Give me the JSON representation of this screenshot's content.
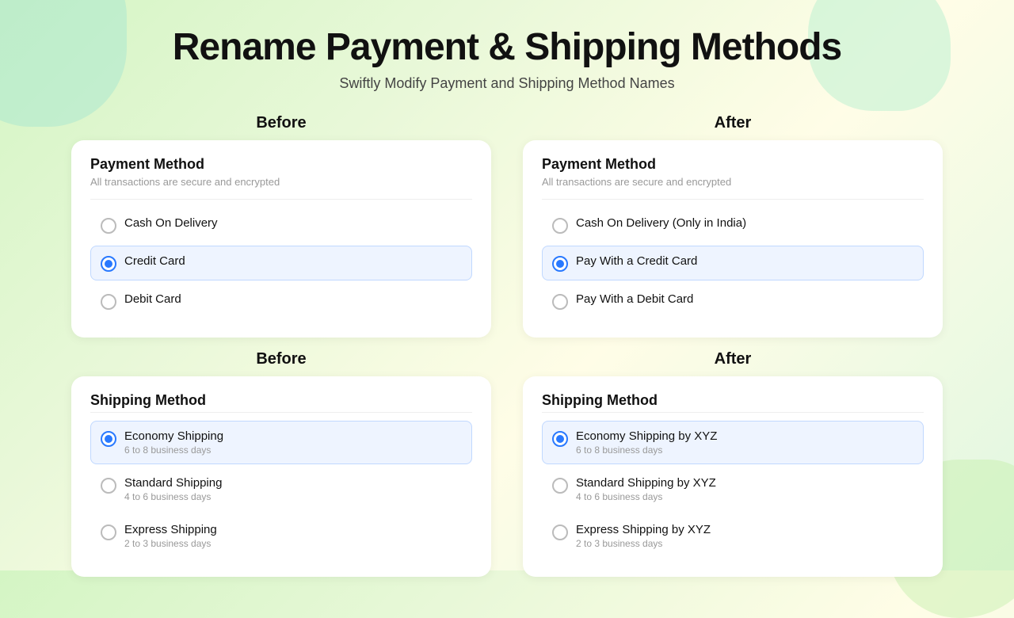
{
  "page": {
    "title": "Rename Payment & Shipping Methods",
    "subtitle": "Swiftly Modify Payment and Shipping Method Names"
  },
  "paymentBefore": {
    "section_label": "Before",
    "card_title": "Payment Method",
    "card_subtitle": "All transactions are secure and encrypted",
    "options": [
      {
        "label": "Cash On Delivery",
        "sublabel": "",
        "selected": false
      },
      {
        "label": "Credit Card",
        "sublabel": "",
        "selected": true
      },
      {
        "label": "Debit Card",
        "sublabel": "",
        "selected": false
      }
    ]
  },
  "paymentAfter": {
    "section_label": "After",
    "card_title": "Payment Method",
    "card_subtitle": "All transactions are secure and encrypted",
    "options": [
      {
        "label": "Cash On Delivery (Only in India)",
        "sublabel": "",
        "selected": false
      },
      {
        "label": "Pay With a Credit Card",
        "sublabel": "",
        "selected": true
      },
      {
        "label": "Pay With a Debit Card",
        "sublabel": "",
        "selected": false
      }
    ]
  },
  "shippingBefore": {
    "section_label": "Before",
    "card_title": "Shipping Method",
    "options": [
      {
        "label": "Economy Shipping",
        "sublabel": "6 to 8 business days",
        "selected": true
      },
      {
        "label": "Standard Shipping",
        "sublabel": "4 to 6 business days",
        "selected": false
      },
      {
        "label": "Express Shipping",
        "sublabel": "2 to 3 business days",
        "selected": false
      }
    ]
  },
  "shippingAfter": {
    "section_label": "After",
    "card_title": "Shipping Method",
    "options": [
      {
        "label": "Economy Shipping by XYZ",
        "sublabel": "6 to 8 business days",
        "selected": true
      },
      {
        "label": "Standard Shipping by XYZ",
        "sublabel": "4 to 6 business days",
        "selected": false
      },
      {
        "label": "Express Shipping by XYZ",
        "sublabel": "2 to 3 business days",
        "selected": false
      }
    ]
  }
}
